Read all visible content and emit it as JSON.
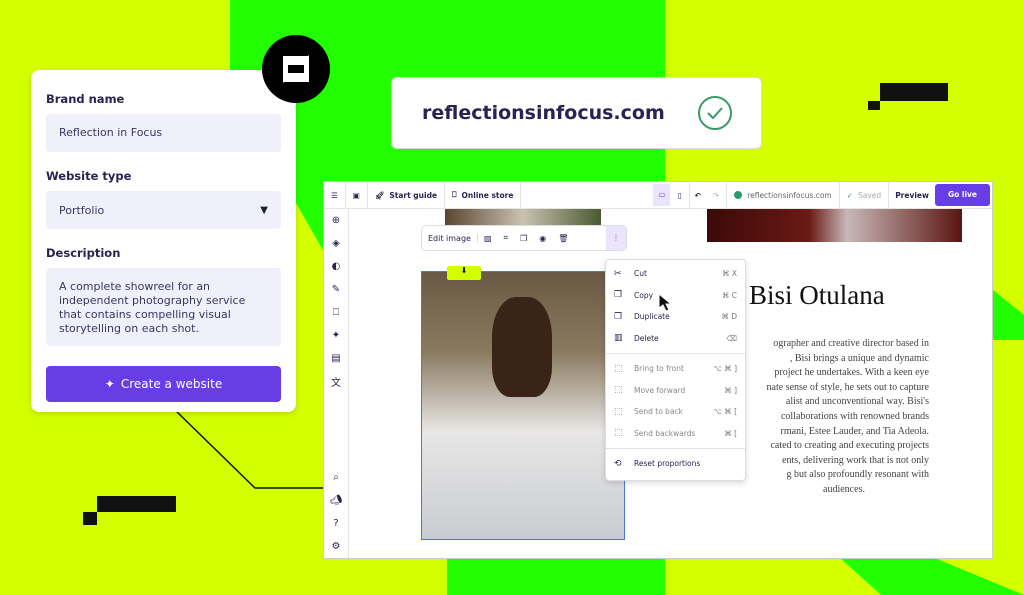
{
  "colors": {
    "lime": "#d4ff00",
    "green": "#22ff00",
    "accent": "#673de6"
  },
  "form": {
    "brand_label": "Brand name",
    "brand_value": "Reflection in Focus",
    "type_label": "Website type",
    "type_value": "Portfolio",
    "desc_label": "Description",
    "desc_value": "A complete showreel for an independent photography service that contains compelling visual storytelling on each shot.",
    "create_label": "Create a website"
  },
  "domain": {
    "name": "reflectionsinfocus.com",
    "status_icon": "check-circle-icon"
  },
  "toolbar": {
    "start_guide": "Start guide",
    "online_store": "Online store",
    "url": "reflectionsinfocus.com",
    "saved": "Saved",
    "preview": "Preview",
    "go_live": "Go live"
  },
  "image_toolbar": {
    "edit_image": "Edit image"
  },
  "context_menu": [
    {
      "label": "Cut",
      "shortcut": "⌘ X",
      "icon": "scissors-icon"
    },
    {
      "label": "Copy",
      "shortcut": "⌘ C",
      "icon": "copy-icon"
    },
    {
      "label": "Duplicate",
      "shortcut": "⌘ D",
      "icon": "duplicate-icon"
    },
    {
      "label": "Delete",
      "shortcut": "⌫",
      "icon": "trash-icon"
    },
    {
      "label": "Bring to front",
      "shortcut": "⌥ ⌘ ]",
      "icon": "layer-icon"
    },
    {
      "label": "Move forward",
      "shortcut": "⌘ ]",
      "icon": "layer-icon"
    },
    {
      "label": "Send to back",
      "shortcut": "⌥ ⌘ [",
      "icon": "layer-icon"
    },
    {
      "label": "Send backwards",
      "shortcut": "⌘ [",
      "icon": "layer-icon"
    },
    {
      "label": "Reset proportions",
      "icon": "reset-icon"
    }
  ],
  "page": {
    "name": "Bisi Otulana",
    "bio_lines": [
      "ographer and creative director based in",
      ", Bisi brings a unique and dynamic",
      "project he undertakes. With a keen eye",
      "nate sense of style, he sets out to capture",
      "alist and unconventional way.  Bisi's",
      "collaborations with renowned brands",
      "rmani, Estee Lauder, and Tia Adeola.",
      "cated to creating and executing projects",
      "ents, delivering work that is not only",
      "g but also profoundly resonant with",
      "audiences."
    ]
  }
}
